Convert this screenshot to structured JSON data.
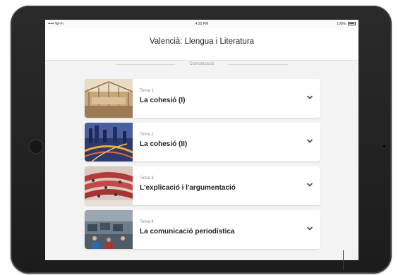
{
  "status_bar": {
    "carrier": "••••• Wi-Fi",
    "time": "4:25 PM",
    "battery": "100%"
  },
  "header": {
    "title": "Valencià: Llengua i Literatura"
  },
  "section": {
    "label": "Comunicació"
  },
  "topics": [
    {
      "number": "Tema 1",
      "title": "La cohesió (I)",
      "thumb": "library-hall-photo"
    },
    {
      "number": "Tema 2",
      "title": "La cohesió (II)",
      "thumb": "city-highway-night-photo"
    },
    {
      "number": "Tema 3",
      "title": "L'explicació i l'argumentació",
      "thumb": "parliament-chamber-photo"
    },
    {
      "number": "Tema 4",
      "title": "La comunicació periodística",
      "thumb": "newsroom-photo"
    }
  ],
  "icons": {
    "expand": "chevron-down-icon",
    "battery": "battery-icon"
  },
  "colors": {
    "background": "#f3f3f3",
    "card": "#ffffff",
    "title_text": "#222222",
    "muted_text": "#8a8a8a"
  }
}
